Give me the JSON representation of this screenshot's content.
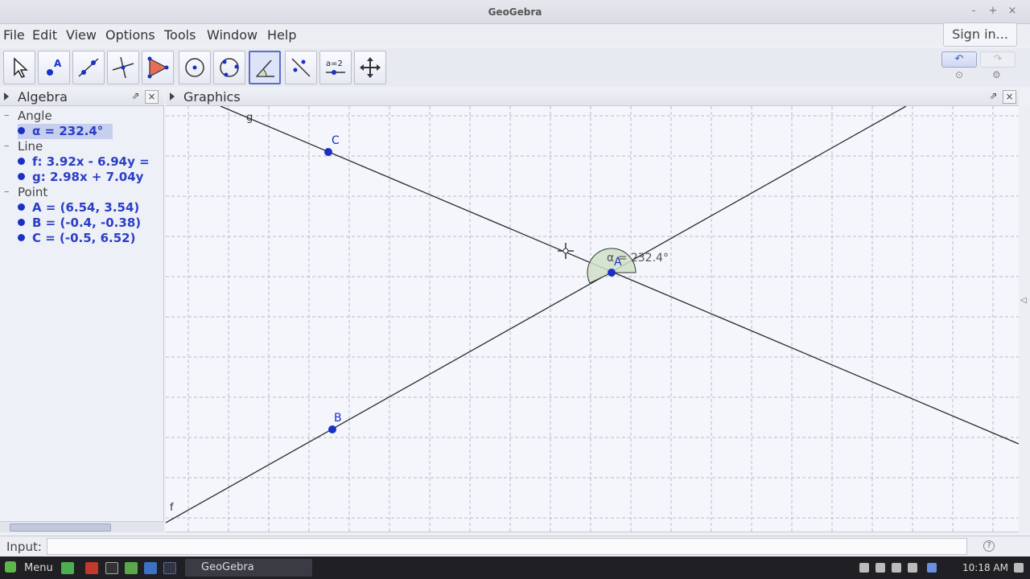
{
  "window": {
    "title": "GeoGebra",
    "controls": [
      "-",
      "+",
      "×"
    ]
  },
  "menu": [
    "File",
    "Edit",
    "View",
    "Options",
    "Tools",
    "Window",
    "Help"
  ],
  "signin_label": "Sign in...",
  "toolbar": {
    "tools": [
      "move-tool-icon",
      "point-tool-icon",
      "line-tool-icon",
      "perpendicular-tool-icon",
      "polygon-tool-icon",
      "circle-tool-icon",
      "circle-three-points-tool-icon",
      "angle-tool-icon",
      "reflect-tool-icon",
      "slider-tool-icon",
      "move-graphics-tool-icon"
    ],
    "slider_label": "a=2",
    "selected_index": 7,
    "undo_glyph": "↶",
    "redo_glyph": "↷"
  },
  "algebra": {
    "title": "Algebra",
    "categories": [
      {
        "name": "Angle",
        "items": [
          "α = 232.4°"
        ]
      },
      {
        "name": "Line",
        "items": [
          "f: 3.92x - 6.94y =",
          "g: 2.98x + 7.04y"
        ]
      },
      {
        "name": "Point",
        "items": [
          "A = (6.54, 3.54)",
          "B = (-0.4, -0.38)",
          "C = (-0.5, 6.52)"
        ]
      }
    ]
  },
  "graphics": {
    "title": "Graphics",
    "labels": {
      "g": "g",
      "f": "f",
      "A": "A",
      "B": "B",
      "C": "C",
      "angle": "α = 232.4°"
    }
  },
  "input": {
    "label": "Input:",
    "value": ""
  },
  "taskbar": {
    "menu_label": "Menu",
    "task_label": "GeoGebra",
    "clock": "10:18 AM"
  },
  "colors": {
    "point": "#1a30c4",
    "angle_fill": "#cfe0c8",
    "line": "#2b2b2b",
    "grid": "#b8bccb"
  }
}
